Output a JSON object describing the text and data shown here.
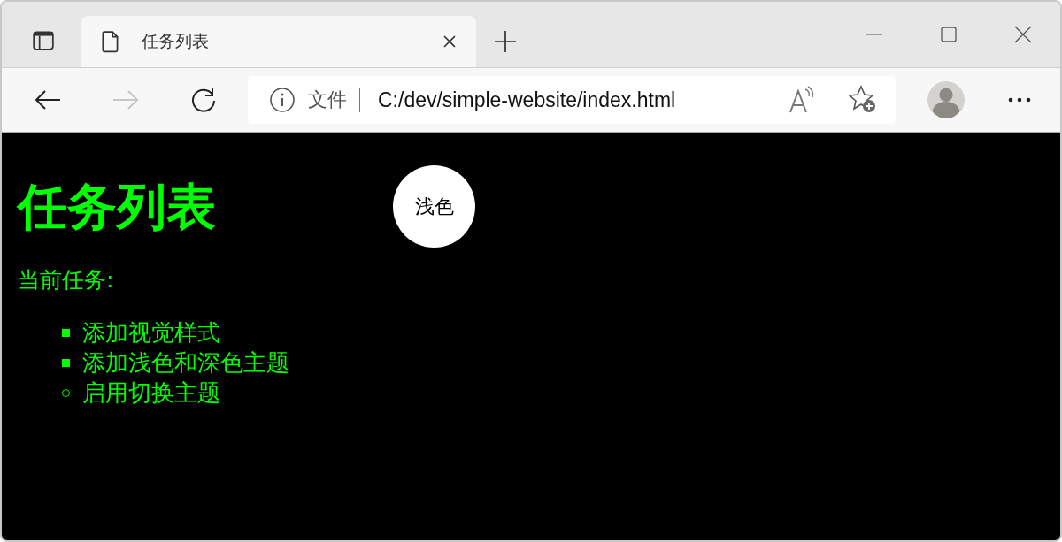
{
  "tab": {
    "title": "任务列表",
    "selected": true
  },
  "address_bar": {
    "security_label": "文件",
    "url": "C:/dev/simple-website/index.html"
  },
  "page": {
    "heading": "任务列表",
    "theme_button": "浅色",
    "subheading": "当前任务:",
    "tasks": [
      {
        "text": "添加视觉样式",
        "done": true
      },
      {
        "text": "添加浅色和深色主题",
        "done": true
      },
      {
        "text": "启用切换主题",
        "done": false
      }
    ]
  }
}
